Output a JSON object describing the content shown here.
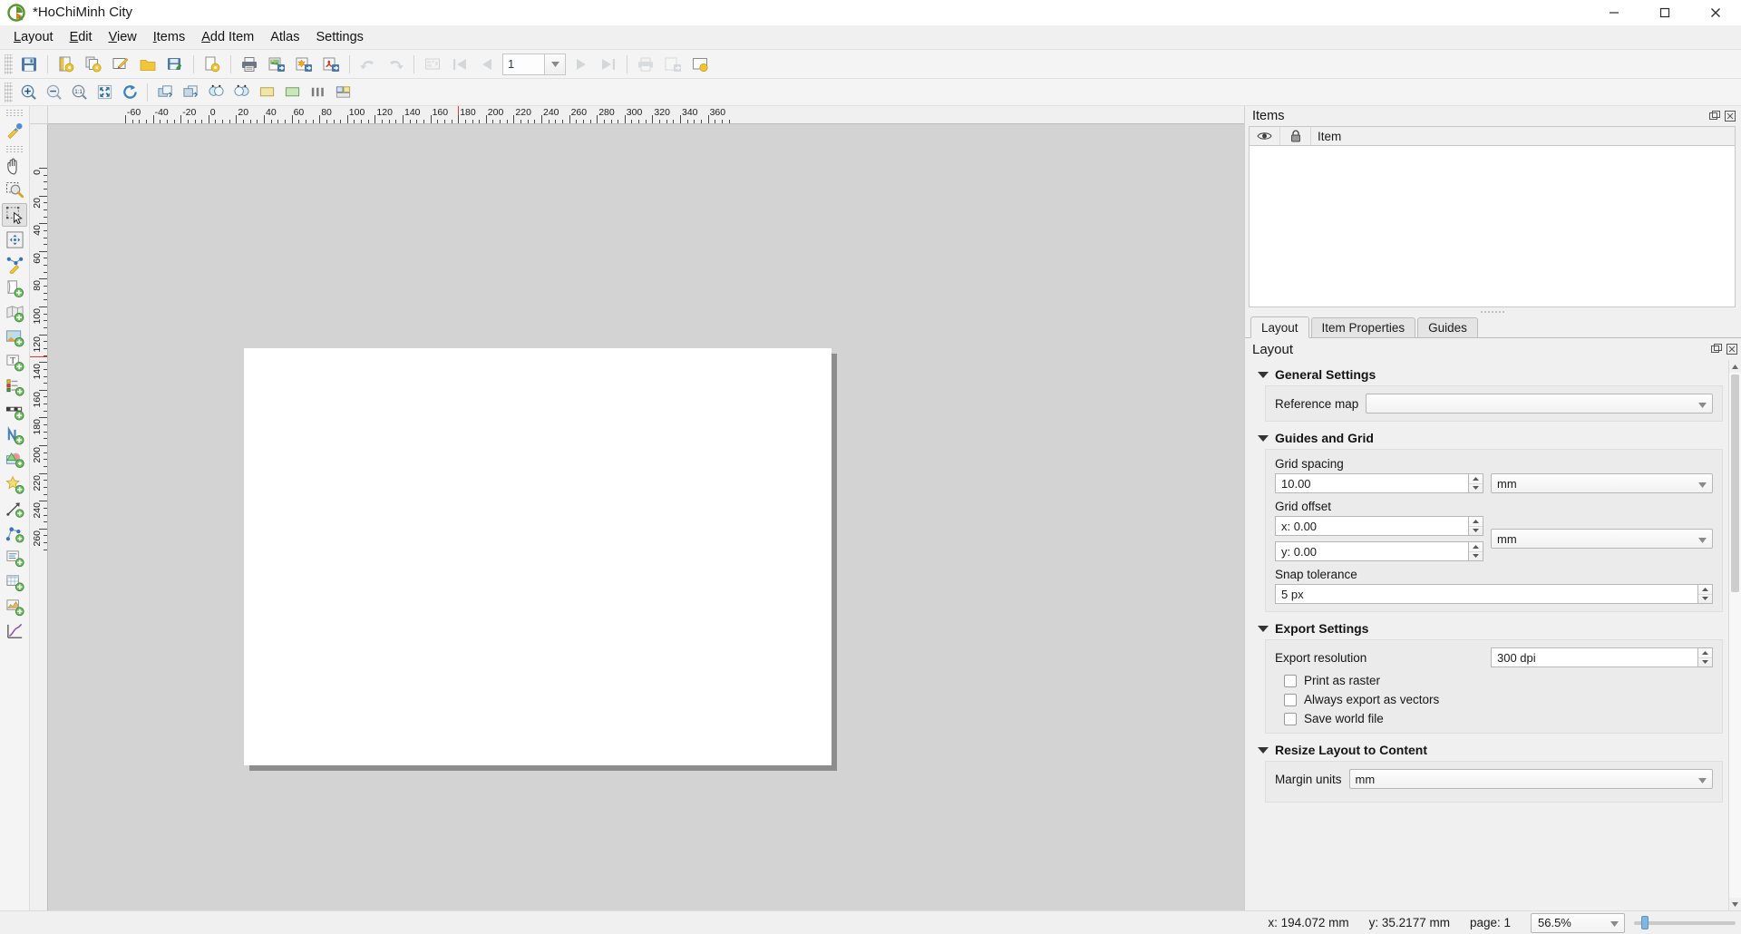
{
  "window": {
    "title": "*HoChiMinh City",
    "logo_icon": "qgis-logo-icon",
    "minimize_label": "Minimize",
    "maximize_label": "Maximize",
    "close_label": "Close"
  },
  "menubar": {
    "items": [
      {
        "label": "Layout",
        "mnemonic": "L"
      },
      {
        "label": "Edit",
        "mnemonic": "E"
      },
      {
        "label": "View",
        "mnemonic": "V"
      },
      {
        "label": "Items",
        "mnemonic": "I"
      },
      {
        "label": "Add Item",
        "mnemonic": "A"
      },
      {
        "label": "Atlas",
        "mnemonic": ""
      },
      {
        "label": "Settings",
        "mnemonic": ""
      }
    ]
  },
  "toolbar_main": {
    "buttons": [
      {
        "name": "save-project-icon",
        "tooltip": "Save Project",
        "disabled": false
      },
      {
        "name": "new-layout-icon",
        "tooltip": "New Layout",
        "disabled": false
      },
      {
        "name": "duplicate-layout-icon",
        "tooltip": "Duplicate Layout",
        "disabled": false
      },
      {
        "name": "layout-manager-icon",
        "tooltip": "Layout Manager",
        "disabled": false
      },
      {
        "name": "open-template-icon",
        "tooltip": "Add Items from Template",
        "disabled": false
      },
      {
        "name": "save-template-icon",
        "tooltip": "Save as Template",
        "disabled": false
      },
      {
        "name": "layout-properties-icon",
        "tooltip": "Layout Properties",
        "disabled": false
      },
      {
        "name": "print-icon",
        "tooltip": "Print Layout",
        "disabled": false
      },
      {
        "name": "export-image-icon",
        "tooltip": "Export as Image",
        "disabled": false
      },
      {
        "name": "export-svg-icon",
        "tooltip": "Export as SVG",
        "disabled": false
      },
      {
        "name": "export-pdf-icon",
        "tooltip": "Export as PDF",
        "disabled": false
      },
      {
        "name": "undo-icon",
        "tooltip": "Undo",
        "disabled": true
      },
      {
        "name": "redo-icon",
        "tooltip": "Redo",
        "disabled": true
      },
      {
        "name": "atlas-preview-icon",
        "tooltip": "Preview Atlas",
        "disabled": true
      },
      {
        "name": "atlas-first-icon",
        "tooltip": "First Feature",
        "disabled": true
      },
      {
        "name": "atlas-prev-icon",
        "tooltip": "Previous Feature",
        "disabled": true
      },
      {
        "name": "atlas-next-icon",
        "tooltip": "Next Feature",
        "disabled": true
      },
      {
        "name": "atlas-last-icon",
        "tooltip": "Last Feature",
        "disabled": true
      },
      {
        "name": "atlas-print-icon",
        "tooltip": "Print Atlas",
        "disabled": true
      },
      {
        "name": "atlas-export-image-icon",
        "tooltip": "Export Atlas as Images",
        "disabled": true
      },
      {
        "name": "atlas-settings-icon",
        "tooltip": "Atlas Settings",
        "disabled": false
      }
    ],
    "page_value": "1"
  },
  "toolbar_nav": {
    "buttons": [
      {
        "name": "zoom-in-icon",
        "tooltip": "Zoom In"
      },
      {
        "name": "zoom-out-icon",
        "tooltip": "Zoom Out"
      },
      {
        "name": "zoom-actual-icon",
        "tooltip": "Zoom to 100%"
      },
      {
        "name": "zoom-full-icon",
        "tooltip": "Zoom Full"
      },
      {
        "name": "refresh-icon",
        "tooltip": "Refresh View"
      },
      {
        "name": "raise-items-icon",
        "tooltip": "Raise Selected Items"
      },
      {
        "name": "lower-items-icon",
        "tooltip": "Lower Selected Items"
      },
      {
        "name": "bring-front-icon",
        "tooltip": "Bring to Front"
      },
      {
        "name": "send-back-icon",
        "tooltip": "Send to Back"
      },
      {
        "name": "align-left-icon",
        "tooltip": "Align Left"
      },
      {
        "name": "align-right-icon",
        "tooltip": "Align Right"
      },
      {
        "name": "group-items-icon",
        "tooltip": "Group Items"
      },
      {
        "name": "ungroup-items-icon",
        "tooltip": "Ungroup Items"
      }
    ]
  },
  "toolbar_tools": {
    "buttons": [
      {
        "name": "pan-layout-icon",
        "tooltip": "Pan Layout",
        "checked": false
      },
      {
        "name": "zoom-tool-icon",
        "tooltip": "Zoom",
        "checked": false
      },
      {
        "name": "select-move-item-icon",
        "tooltip": "Select/Move Item",
        "checked": true
      },
      {
        "name": "move-item-content-icon",
        "tooltip": "Move Item Content",
        "checked": false
      },
      {
        "name": "edit-nodes-icon",
        "tooltip": "Edit Nodes Item",
        "checked": false
      },
      {
        "name": "add-page-icon",
        "tooltip": "Add Pages to Layout",
        "checked": false
      },
      {
        "name": "add-map-icon",
        "tooltip": "Add Map",
        "checked": false
      },
      {
        "name": "add-picture-icon",
        "tooltip": "Add Picture",
        "checked": false
      },
      {
        "name": "add-label-icon",
        "tooltip": "Add Label",
        "checked": false
      },
      {
        "name": "add-legend-icon",
        "tooltip": "Add Legend",
        "checked": false
      },
      {
        "name": "add-scalebar-icon",
        "tooltip": "Add Scale Bar",
        "checked": false
      },
      {
        "name": "add-north-arrow-icon",
        "tooltip": "Add North Arrow",
        "checked": false
      },
      {
        "name": "add-shape-icon",
        "tooltip": "Add Shape",
        "checked": false
      },
      {
        "name": "add-marker-icon",
        "tooltip": "Add Marker",
        "checked": false
      },
      {
        "name": "add-arrow-icon",
        "tooltip": "Add Arrow",
        "checked": false
      },
      {
        "name": "add-node-item-icon",
        "tooltip": "Add Node Item",
        "checked": false
      },
      {
        "name": "add-html-icon",
        "tooltip": "Add HTML",
        "checked": false
      },
      {
        "name": "add-attribute-table-icon",
        "tooltip": "Add Attribute Table",
        "checked": false
      },
      {
        "name": "add-elevation-profile-icon",
        "tooltip": "Add Elevation Profile",
        "checked": false
      },
      {
        "name": "add-chart-icon",
        "tooltip": "Add Chart",
        "checked": false
      }
    ]
  },
  "rulers": {
    "h_labels": [
      "-60",
      "-40",
      "-20",
      "0",
      "20",
      "40",
      "60",
      "80",
      "100",
      "120",
      "140",
      "160",
      "180",
      "200",
      "220",
      "240",
      "260",
      "280",
      "300",
      "320",
      "340",
      "360"
    ],
    "v_labels": [
      "0",
      "20",
      "40",
      "60",
      "80",
      "100",
      "120",
      "140",
      "160",
      "180",
      "200",
      "220",
      "240",
      "260"
    ],
    "unit": "mm"
  },
  "items_dock": {
    "title": "Items",
    "float_icon": "undock-icon",
    "close_icon": "close-icon",
    "columns": [
      "Item"
    ],
    "eye_icon": "eye-icon",
    "lock_icon": "lock-icon",
    "rows": []
  },
  "tabs": [
    {
      "label": "Layout",
      "active": true
    },
    {
      "label": "Item Properties",
      "active": false
    },
    {
      "label": "Guides",
      "active": false
    }
  ],
  "layout_panel": {
    "title": "Layout",
    "float_icon": "undock-icon",
    "close_icon": "close-icon",
    "general_settings": {
      "title": "General Settings",
      "reference_map_label": "Reference map",
      "reference_map_value": ""
    },
    "guides_and_grid": {
      "title": "Guides and Grid",
      "grid_spacing_label": "Grid spacing",
      "grid_spacing_value": "10.00",
      "grid_spacing_unit": "mm",
      "grid_offset_label": "Grid offset",
      "grid_offset_x": "x: 0.00",
      "grid_offset_y": "y: 0.00",
      "grid_offset_unit": "mm",
      "snap_tolerance_label": "Snap tolerance",
      "snap_tolerance_value": "5 px"
    },
    "export_settings": {
      "title": "Export Settings",
      "export_resolution_label": "Export resolution",
      "export_resolution_value": "300 dpi",
      "print_as_raster_label": "Print as raster",
      "print_as_raster_checked": false,
      "always_export_vectors_label": "Always export as vectors",
      "always_export_vectors_checked": false,
      "save_world_file_label": "Save world file",
      "save_world_file_checked": false
    },
    "resize_layout": {
      "title": "Resize Layout to Content",
      "margin_units_label": "Margin units",
      "margin_units_value": "mm"
    }
  },
  "statusbar": {
    "x_label": "x: 194.072 mm",
    "y_label": "y: 35.2177 mm",
    "page_label": "page: 1",
    "zoom_value": "56.5%"
  },
  "colors": {
    "window_bg": "#f0f0f0",
    "canvas_bg": "#d3d3d3",
    "page_white": "#ffffff",
    "page_shadow": "#8d8d8d",
    "accent_blue": "#3a76b8",
    "ruler_red": "#e03a3a",
    "qgis_green": "#589632"
  }
}
